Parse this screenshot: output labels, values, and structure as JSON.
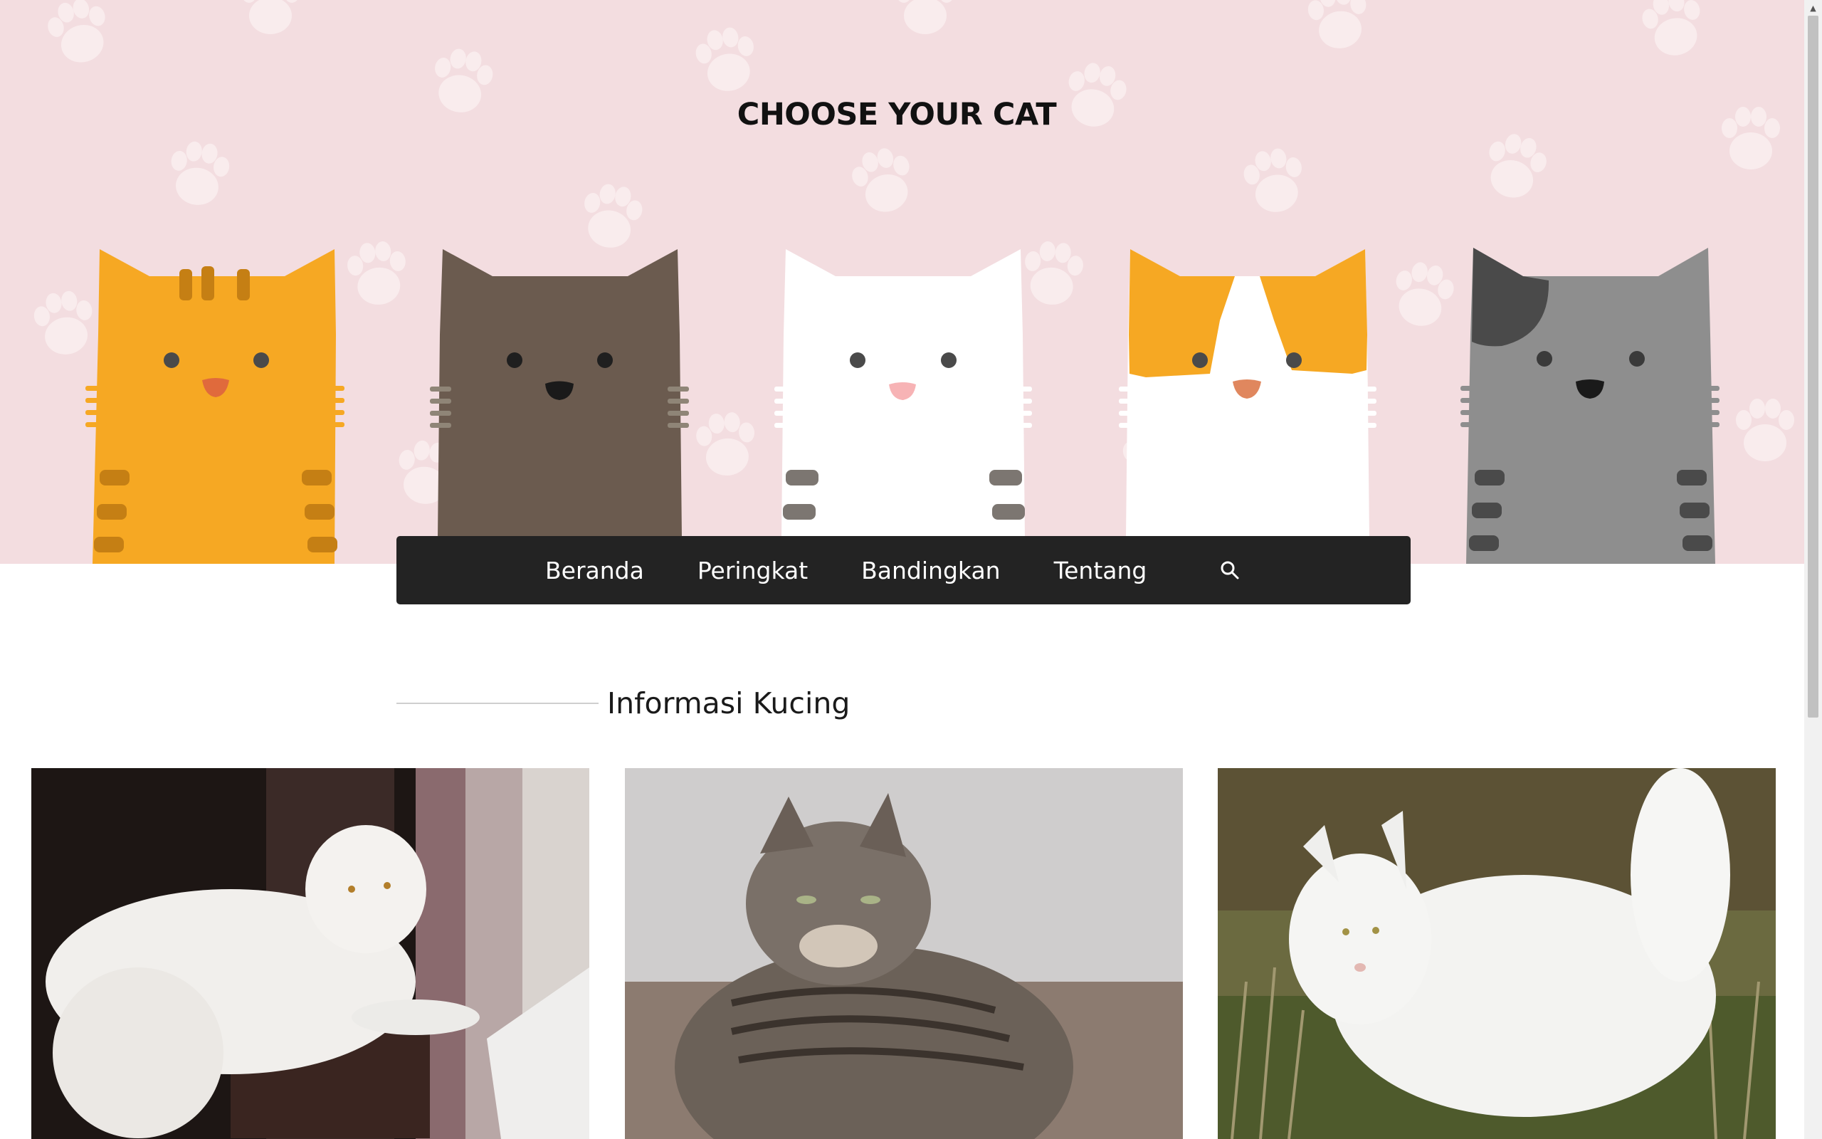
{
  "header": {
    "title": "CHOOSE YOUR CAT",
    "background_color": "#f3dde0",
    "cats": [
      {
        "name": "orange-tabby",
        "fur": "#f6a823",
        "stripe": "#c57f14",
        "nose": "#e06a3c"
      },
      {
        "name": "brown",
        "fur": "#6b5b4f",
        "stripe": "#8f8577",
        "nose": "#1a1a1a"
      },
      {
        "name": "white",
        "fur": "#ffffff",
        "stripe": "#7c7671",
        "nose": "#f7b3b5"
      },
      {
        "name": "calico",
        "fur": "#ffffff",
        "patch": "#f6a823",
        "nose": "#e0875e"
      },
      {
        "name": "gray",
        "fur": "#8e8e8e",
        "patch": "#4a4a4a",
        "stripe": "#4a4a4a",
        "nose": "#1a1a1a"
      }
    ]
  },
  "nav": {
    "items": [
      {
        "label": "Beranda"
      },
      {
        "label": "Peringkat"
      },
      {
        "label": "Bandingkan"
      },
      {
        "label": "Tentang"
      }
    ],
    "search_icon": "search-icon",
    "background_color": "#232323"
  },
  "section": {
    "title": "Informasi Kucing"
  },
  "cards": [
    {
      "image": "white-persian-cat-photo"
    },
    {
      "image": "tabby-cat-photo"
    },
    {
      "image": "white-longhair-cat-photo"
    }
  ]
}
